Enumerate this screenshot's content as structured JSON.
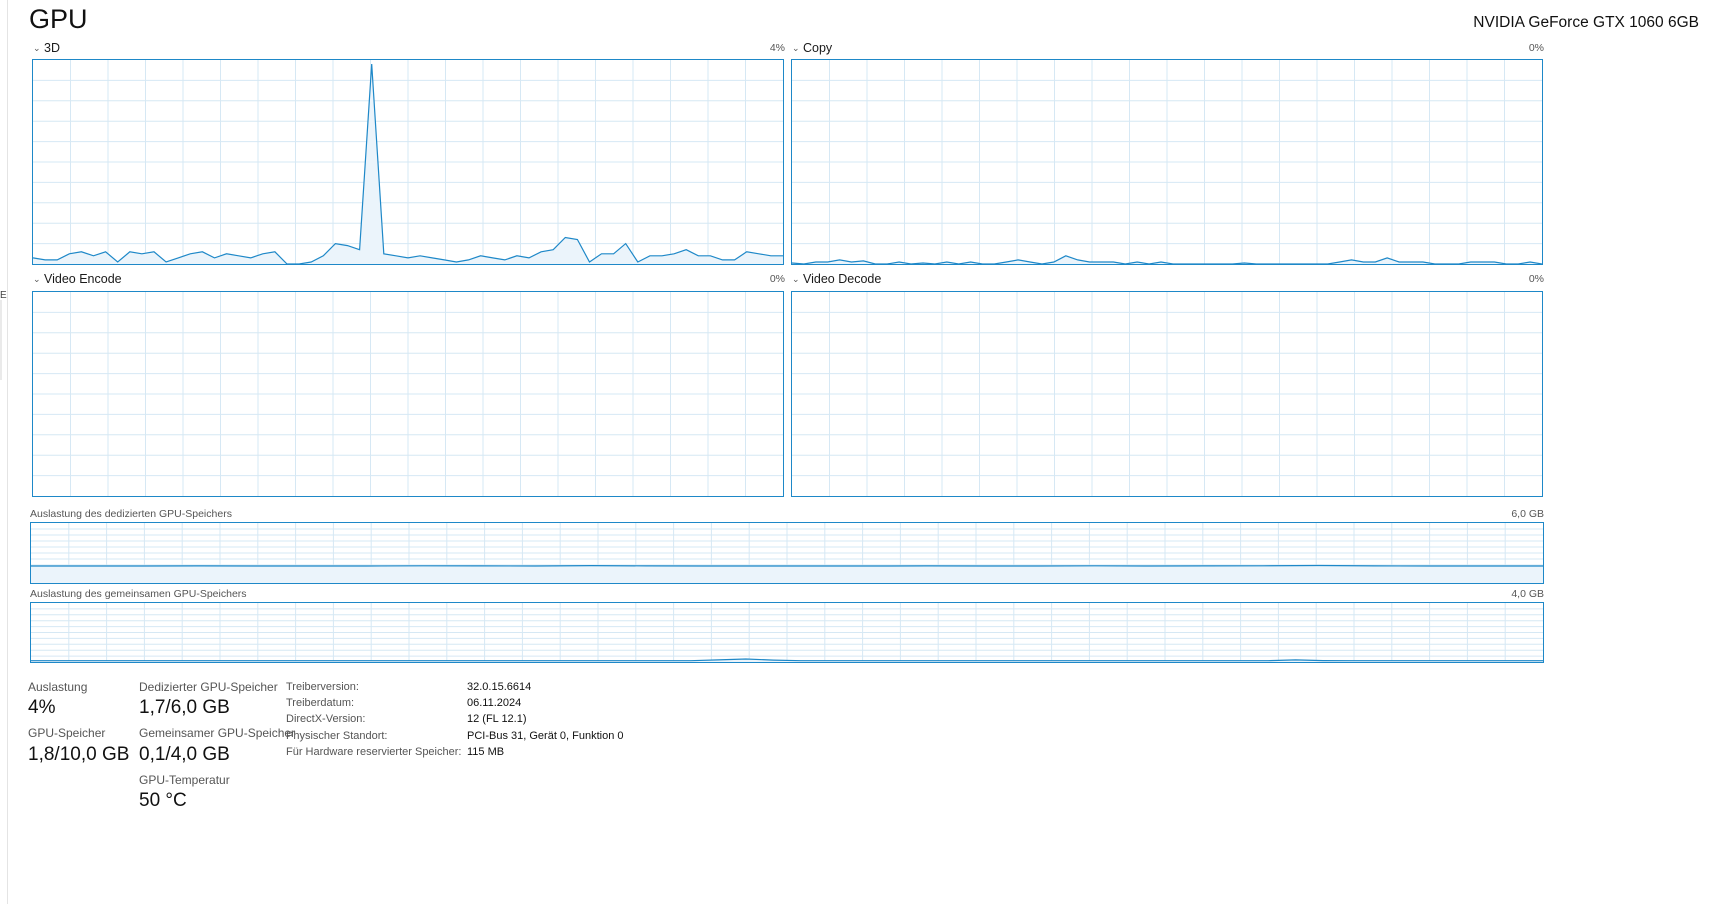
{
  "header": {
    "title": "GPU",
    "device": "NVIDIA GeForce GTX 1060 6GB"
  },
  "engines": [
    {
      "label": "3D",
      "percent": "4%",
      "series": [
        3,
        2,
        2,
        5,
        6,
        4,
        6,
        1,
        6,
        5,
        6,
        1,
        3,
        5,
        6,
        3,
        5,
        4,
        3,
        5,
        6,
        0,
        0,
        1,
        4,
        10,
        9,
        7,
        98,
        5,
        4,
        3,
        4,
        3,
        2,
        1,
        2,
        4,
        3,
        2,
        4,
        3,
        6,
        7,
        13,
        12,
        1,
        5,
        5,
        10,
        1,
        4,
        4,
        5,
        7,
        4,
        4,
        2,
        2,
        6,
        5,
        4,
        4
      ]
    },
    {
      "label": "Copy",
      "percent": "0%",
      "series": [
        0.5,
        0,
        1,
        1,
        2,
        1,
        1.5,
        0,
        0,
        1,
        0,
        0.5,
        0,
        1,
        0,
        1,
        0,
        0,
        1,
        2,
        1,
        0,
        1,
        4,
        2,
        1,
        1,
        1,
        0,
        1,
        0,
        1,
        0,
        0,
        0,
        0,
        0,
        0,
        0.5,
        0,
        0,
        0,
        0,
        0,
        0,
        0,
        1,
        2,
        1,
        1,
        3,
        1,
        1,
        1,
        0,
        0,
        0,
        1,
        1,
        1,
        0,
        0,
        1,
        0
      ]
    },
    {
      "label": "Video Encode",
      "percent": "0%",
      "series": []
    },
    {
      "label": "Video Decode",
      "percent": "0%",
      "series": []
    }
  ],
  "memory_graphs": [
    {
      "label": "Auslastung des dedizierten GPU-Speichers",
      "max": "6,0 GB",
      "series": [
        28.3,
        28.4,
        28.3,
        28.5,
        28.4,
        28.3,
        28.4,
        28.6,
        28.5,
        28.3,
        29.0,
        28.5,
        28.4,
        28.3,
        28.4,
        28.3,
        28.5,
        28.4,
        28.3,
        28.6,
        28.4,
        28.5,
        28.7,
        29.2,
        28.5,
        28.4,
        28.3,
        28.3
      ]
    },
    {
      "label": "Auslastung des gemeinsamen GPU-Speichers",
      "max": "4,0 GB",
      "series": [
        2.2,
        2.2,
        2.2,
        2.2,
        2.2,
        2.2,
        2.2,
        2.2,
        2.2,
        2.2,
        2.2,
        2.2,
        2.2,
        2.2,
        2.2,
        2.2,
        2.2,
        2.2,
        2.2,
        2.2,
        2.2,
        2.2,
        2.2,
        2.2,
        2.2,
        3.5,
        5.0,
        3.2,
        2.2,
        2.2,
        2.2,
        2.2,
        2.2,
        2.2,
        2.2,
        2.2,
        2.2,
        2.2,
        2.2,
        2.2,
        2.2,
        2.2,
        2.2,
        2.2,
        2.2,
        2.2,
        3.5,
        2.3,
        2.2,
        2.2,
        2.2,
        2.2,
        2.2,
        2.2,
        2.2,
        2.2
      ]
    }
  ],
  "stats": {
    "utilization_label": "Auslastung",
    "utilization_value": "4%",
    "gpu_memory_label": "GPU-Speicher",
    "gpu_memory_value": "1,8/10,0 GB",
    "dedicated_label": "Dedizierter GPU-Speicher",
    "dedicated_value": "1,7/6,0 GB",
    "shared_label": "Gemeinsamer GPU-Speicher",
    "shared_value": "0,1/4,0 GB",
    "temp_label": "GPU-Temperatur",
    "temp_value": "50 °C"
  },
  "info": [
    {
      "key": "Treiberversion:",
      "value": "32.0.15.6614"
    },
    {
      "key": "Treiberdatum:",
      "value": "06.11.2024"
    },
    {
      "key": "DirectX-Version:",
      "value": "12 (FL 12.1)"
    },
    {
      "key": "Physischer Standort:",
      "value": "PCI-Bus 31, Gerät 0, Funktion 0"
    },
    {
      "key": "Für Hardware reservierter Speicher:",
      "value": "115 MB"
    }
  ],
  "sidebar_edge": {
    "mark": "E"
  },
  "colors": {
    "accent": "#1e88c8",
    "grid": "#d6e8f4",
    "fill": "#ebf4fb"
  }
}
